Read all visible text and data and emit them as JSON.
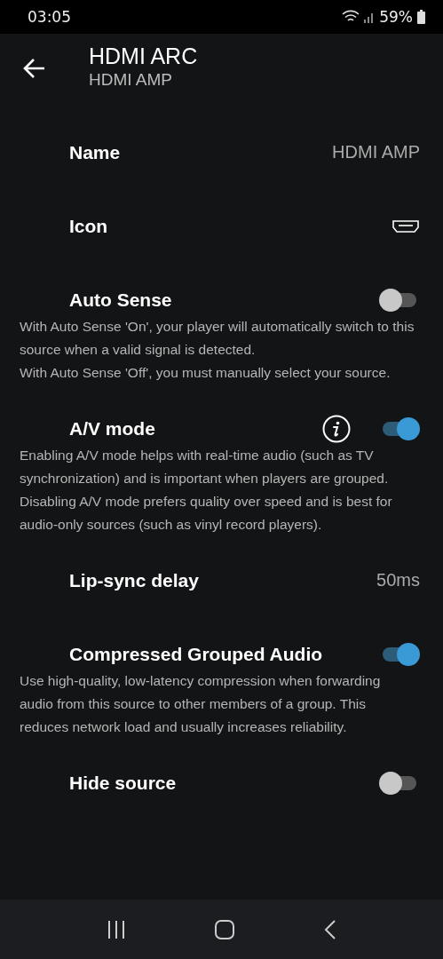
{
  "status_bar": {
    "time": "03:05",
    "battery": "59%"
  },
  "header": {
    "title": "HDMI ARC",
    "subtitle": "HDMI AMP"
  },
  "settings": [
    {
      "kind": "value",
      "label": "Name",
      "value": "HDMI AMP"
    },
    {
      "kind": "icon",
      "label": "Icon"
    },
    {
      "kind": "toggle",
      "label": "Auto Sense",
      "on": false,
      "description": "With Auto Sense 'On', your player will automatically switch to this source when a valid signal is detected.\nWith Auto Sense 'Off', you must manually select your source."
    },
    {
      "kind": "toggle",
      "label": "A/V mode",
      "on": true,
      "info": true,
      "description": "Enabling A/V mode helps with real-time audio (such as TV synchronization) and is important when players are grouped. Disabling A/V mode prefers quality over speed and is best for audio-only sources (such as vinyl record players)."
    },
    {
      "kind": "value",
      "label": "Lip-sync delay",
      "value": "50ms"
    },
    {
      "kind": "toggle",
      "label": "Compressed Grouped Audio",
      "on": true,
      "description": "Use high-quality, low-latency compression when forwarding audio from this source to other members of a group. This reduces network load and usually increases reliability."
    },
    {
      "kind": "toggle",
      "label": "Hide source",
      "on": false
    }
  ]
}
